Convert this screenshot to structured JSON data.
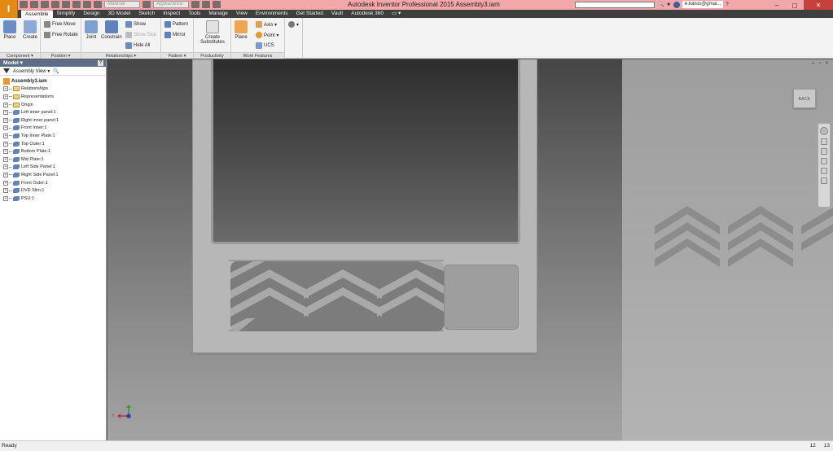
{
  "app": {
    "title": "Autodesk Inventor Professional 2015   Assembly3.iam",
    "logo": "I",
    "material_placeholder": "Material",
    "appearance_placeholder": "Appearance",
    "user": "e.katsis@gmai...",
    "window_buttons": [
      "–",
      "◻",
      "✕"
    ]
  },
  "tabs": [
    {
      "label": "Assemble",
      "active": true
    },
    {
      "label": "Simplify"
    },
    {
      "label": "Design"
    },
    {
      "label": "3D Model"
    },
    {
      "label": "Sketch"
    },
    {
      "label": "Inspect"
    },
    {
      "label": "Tools"
    },
    {
      "label": "Manage"
    },
    {
      "label": "View"
    },
    {
      "label": "Environments"
    },
    {
      "label": "Get Started"
    },
    {
      "label": "Vault"
    },
    {
      "label": "Autodesk 360"
    }
  ],
  "ribbon": {
    "component": {
      "label": "Component ▾",
      "place": "Place",
      "create": "Create"
    },
    "position": {
      "label": "Position ▾",
      "free_move": "Free Move",
      "free_rotate": "Free Rotate"
    },
    "relationships": {
      "label": "Relationships ▾",
      "joint": "Joint",
      "constrain": "Constrain",
      "show": "Show",
      "show_sick": "Show Sick",
      "hide_all": "Hide All"
    },
    "pattern": {
      "label": "Pattern ▾",
      "pattern": "Pattern",
      "mirror": "Mirror"
    },
    "productivity": {
      "label": "Productivity",
      "create_substitutes_1": "Create",
      "create_substitutes_2": "Substitutes"
    },
    "work_features": {
      "label": "Work Features",
      "plane": "Plane",
      "axis": "Axis ▾",
      "point": "Point ▾",
      "ucs": "UCS"
    }
  },
  "browser": {
    "title": "Model ▾",
    "help": "?",
    "view": "Assembly View",
    "tree": [
      {
        "label": "Assembly3.iam",
        "type": "root"
      },
      {
        "label": "Relationships",
        "type": "folder"
      },
      {
        "label": "Representations",
        "type": "folder"
      },
      {
        "label": "Origin",
        "type": "folder"
      },
      {
        "label": "Left inner panel:1",
        "type": "part"
      },
      {
        "label": "Right inner panel:1",
        "type": "part"
      },
      {
        "label": "Front Inner:1",
        "type": "part"
      },
      {
        "label": "Top Inner Plate:1",
        "type": "part"
      },
      {
        "label": "Top Outer:1",
        "type": "part"
      },
      {
        "label": "Bottom Plate:1",
        "type": "part"
      },
      {
        "label": "Mid Plate:1",
        "type": "part"
      },
      {
        "label": "Left Side Panel:1",
        "type": "part"
      },
      {
        "label": "Right Side Panel:1",
        "type": "part"
      },
      {
        "label": "Front Outer:1",
        "type": "part"
      },
      {
        "label": "DVD Slim:1",
        "type": "part"
      },
      {
        "label": "PSU:1",
        "type": "part"
      }
    ]
  },
  "viewport": {
    "viewcube_label": "BACK",
    "controls": "– ▫ ×",
    "triad_x": "X"
  },
  "status": {
    "text": "Ready",
    "num1": "12",
    "num2": "13"
  }
}
